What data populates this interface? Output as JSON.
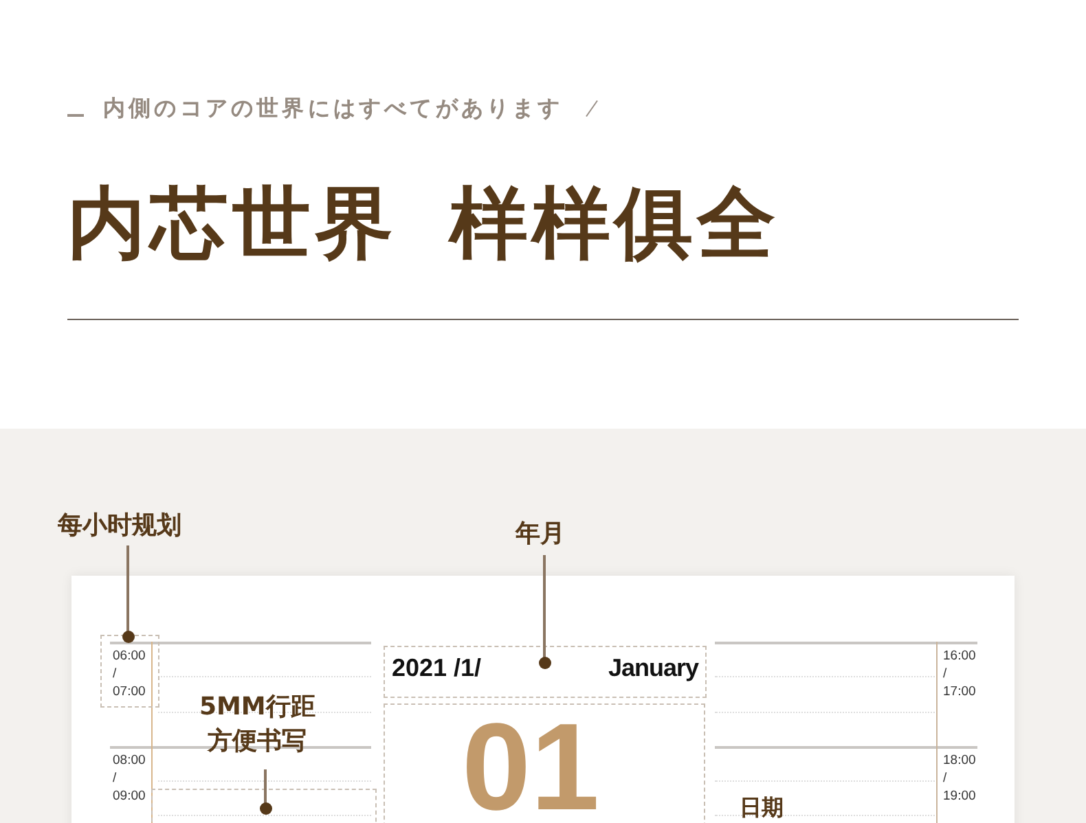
{
  "header": {
    "subtitle": "内側のコアの世界にはすべてがあります",
    "title_left": "内芯世界",
    "title_right": "样样俱全"
  },
  "annotations": [
    {
      "kind": "hourly",
      "lines": [
        "每小时规划"
      ]
    },
    {
      "kind": "month",
      "lines": [
        "年月"
      ]
    },
    {
      "kind": "spacing",
      "lines": [
        "5MM行距",
        "方便书写"
      ]
    },
    {
      "kind": "date",
      "lines": [
        "日期"
      ]
    }
  ],
  "planner": {
    "year_month": "2021 /1/",
    "month_name": "January",
    "day": "01",
    "left_slots": [
      {
        "start": "06:00",
        "sep": "/",
        "end": "07:00"
      },
      {
        "start": "08:00",
        "sep": "/",
        "end": "09:00"
      }
    ],
    "right_slots": [
      {
        "start": "16:00",
        "sep": "/",
        "end": "17:00"
      },
      {
        "start": "18:00",
        "sep": "/",
        "end": "19:00"
      }
    ]
  }
}
